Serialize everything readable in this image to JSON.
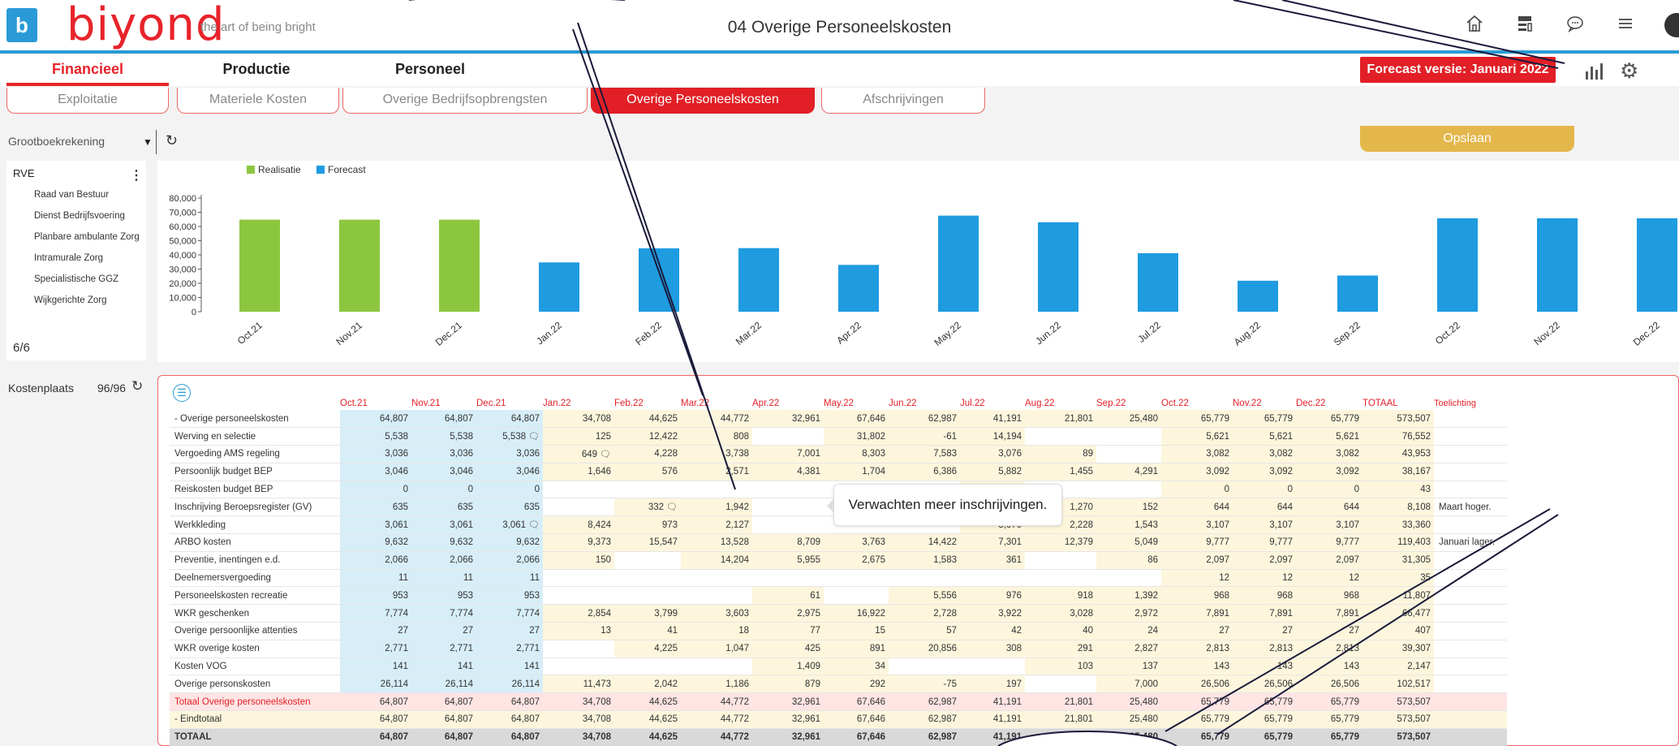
{
  "header": {
    "logo_letter": "b",
    "logo_word": "biyond",
    "tagline": "the art of being bright",
    "title": "04 Overige Personeelskosten"
  },
  "icons": {
    "home": "home-icon",
    "layout": "layout-icon",
    "chat": "chat-icon",
    "menu": "hamburger-menu-icon",
    "chart": "bar-chart-icon",
    "settings": "gear-icon"
  },
  "nav": {
    "tabs": [
      "Financieel",
      "Productie",
      "Personeel"
    ],
    "active": 0,
    "forecast_badge": "Forecast versie: Januari 2022"
  },
  "subtabs": {
    "items": [
      "Exploitatie",
      "Materiele Kosten",
      "Overige Bedrijfsopbrengsten",
      "Overige Personeelskosten",
      "Afschrijvingen"
    ],
    "active": 3
  },
  "filter": {
    "label": "Grootboekrekening",
    "save": "Opslaan"
  },
  "rve": {
    "title": "RVE",
    "items": [
      "Raad van Bestuur",
      "Dienst Bedrijfsvoering",
      "Planbare ambulante Zorg",
      "Intramurale Zorg",
      "Specialistische GGZ",
      "Wijkgerichte Zorg"
    ],
    "count": "6/6"
  },
  "kostenplaats": {
    "label": "Kostenplaats",
    "count": "96/96"
  },
  "colors": {
    "realisatie": "#8cc63f",
    "forecast": "#1f9be0",
    "accent": "#e21f26"
  },
  "chart_data": {
    "type": "bar",
    "categories": [
      "Oct.21",
      "Nov.21",
      "Dec.21",
      "Jan.22",
      "Feb.22",
      "Mar.22",
      "Apr.22",
      "May.22",
      "Jun.22",
      "Jul.22",
      "Aug.22",
      "Sep.22",
      "Oct.22",
      "Nov.22",
      "Dec.22"
    ],
    "series": [
      {
        "name": "Realisatie",
        "values": [
          64807,
          64807,
          64807,
          null,
          null,
          null,
          null,
          null,
          null,
          null,
          null,
          null,
          null,
          null,
          null
        ]
      },
      {
        "name": "Forecast",
        "values": [
          null,
          null,
          null,
          34708,
          44625,
          44772,
          32961,
          67646,
          62987,
          41191,
          21801,
          25480,
          65779,
          65779,
          65779
        ]
      }
    ],
    "yticks": [
      "80,000",
      "70,000",
      "60,000",
      "50,000",
      "40,000",
      "30,000",
      "20,000",
      "10,000",
      "0"
    ],
    "ylim": [
      0,
      80000
    ],
    "legend": "top-left",
    "grid": false
  },
  "table": {
    "columns": [
      "Oct.21",
      "Nov.21",
      "Dec.21",
      "Jan.22",
      "Feb.22",
      "Mar.22",
      "Apr.22",
      "May.22",
      "Jun.22",
      "Jul.22",
      "Aug.22",
      "Sep.22",
      "Oct.22",
      "Nov.22",
      "Dec.22",
      "TOTAAL",
      "Toelichting"
    ],
    "rows": [
      {
        "label": "- Overige personeelskosten",
        "values": [
          "64,807",
          "64,807",
          "64,807",
          "34,708",
          "44,625",
          "44,772",
          "32,961",
          "67,646",
          "62,987",
          "41,191",
          "21,801",
          "25,480",
          "65,779",
          "65,779",
          "65,779",
          "573,507"
        ],
        "note": ""
      },
      {
        "label": "Werving en selectie",
        "values": [
          "5,538",
          "5,538",
          "5,538",
          "125",
          "12,422",
          "808",
          "",
          "31,802",
          "-61",
          "14,194",
          "",
          "",
          "5,621",
          "5,621",
          "5,621",
          "76,552"
        ],
        "note": ""
      },
      {
        "label": "Vergoeding AMS regeling",
        "values": [
          "3,036",
          "3,036",
          "3,036",
          "649",
          "4,228",
          "3,738",
          "7,001",
          "8,303",
          "7,583",
          "3,076",
          "89",
          "",
          "3,082",
          "3,082",
          "3,082",
          "43,953"
        ],
        "note": ""
      },
      {
        "label": "Persoonlijk budget BEP",
        "values": [
          "3,046",
          "3,046",
          "3,046",
          "1,646",
          "576",
          "2,571",
          "4,381",
          "1,704",
          "6,386",
          "5,882",
          "1,455",
          "4,291",
          "3,092",
          "3,092",
          "3,092",
          "38,167"
        ],
        "note": ""
      },
      {
        "label": "Reiskosten budget BEP",
        "values": [
          "0",
          "0",
          "0",
          "",
          "",
          "",
          "",
          "",
          "",
          "42",
          "",
          "",
          "0",
          "0",
          "0",
          "43"
        ],
        "note": ""
      },
      {
        "label": "Inschrijving Beroepsregister (GV)",
        "values": [
          "635",
          "635",
          "635",
          "",
          "332",
          "1,942",
          "",
          "",
          "",
          "1,184",
          "1,270",
          "152",
          "644",
          "644",
          "644",
          "8,108"
        ],
        "note": "Maart hoger."
      },
      {
        "label": "Werkkleding",
        "values": [
          "3,061",
          "3,061",
          "3,061",
          "8,424",
          "973",
          "2,127",
          "",
          "",
          "",
          "3,670",
          "2,228",
          "1,543",
          "3,107",
          "3,107",
          "3,107",
          "33,360"
        ],
        "note": ""
      },
      {
        "label": "ARBO kosten",
        "values": [
          "9,632",
          "9,632",
          "9,632",
          "9,373",
          "15,547",
          "13,528",
          "8,709",
          "3,763",
          "14,422",
          "7,301",
          "12,379",
          "5,049",
          "9,777",
          "9,777",
          "9,777",
          "119,403"
        ],
        "note": "Januari lager."
      },
      {
        "label": "Preventie, inentingen e.d.",
        "values": [
          "2,066",
          "2,066",
          "2,066",
          "150",
          "",
          "14,204",
          "5,955",
          "2,675",
          "1,583",
          "361",
          "",
          "86",
          "2,097",
          "2,097",
          "2,097",
          "31,305"
        ],
        "note": ""
      },
      {
        "label": "Deelnemersvergoeding",
        "values": [
          "11",
          "11",
          "11",
          "",
          "",
          "",
          "",
          "",
          "",
          "",
          "",
          "",
          "12",
          "12",
          "12",
          "35"
        ],
        "note": ""
      },
      {
        "label": "Personeelskosten recreatie",
        "values": [
          "953",
          "953",
          "953",
          "",
          "",
          "",
          "61",
          "",
          "5,556",
          "976",
          "918",
          "1,392",
          "968",
          "968",
          "968",
          "11,807"
        ],
        "note": ""
      },
      {
        "label": "WKR geschenken",
        "values": [
          "7,774",
          "7,774",
          "7,774",
          "2,854",
          "3,799",
          "3,603",
          "2,975",
          "16,922",
          "2,728",
          "3,922",
          "3,028",
          "2,972",
          "7,891",
          "7,891",
          "7,891",
          "66,477"
        ],
        "note": ""
      },
      {
        "label": "Overige persoonlijke attenties",
        "values": [
          "27",
          "27",
          "27",
          "13",
          "41",
          "18",
          "77",
          "15",
          "57",
          "42",
          "40",
          "24",
          "27",
          "27",
          "27",
          "407"
        ],
        "note": ""
      },
      {
        "label": "WKR overige kosten",
        "values": [
          "2,771",
          "2,771",
          "2,771",
          "",
          "4,225",
          "1,047",
          "425",
          "891",
          "20,856",
          "308",
          "291",
          "2,827",
          "2,813",
          "2,813",
          "2,813",
          "39,307"
        ],
        "note": ""
      },
      {
        "label": "Kosten VOG",
        "values": [
          "141",
          "141",
          "141",
          "",
          "",
          "",
          "1,409",
          "34",
          "",
          "",
          "103",
          "137",
          "143",
          "143",
          "143",
          "2,147"
        ],
        "note": ""
      },
      {
        "label": "Overige personskosten",
        "values": [
          "26,114",
          "26,114",
          "26,114",
          "11,473",
          "2,042",
          "1,186",
          "879",
          "292",
          "-75",
          "197",
          "",
          "7,000",
          "26,506",
          "26,506",
          "26,506",
          "102,517"
        ],
        "note": ""
      },
      {
        "label": "Totaal Overige personeelskosten",
        "values": [
          "64,807",
          "64,807",
          "64,807",
          "34,708",
          "44,625",
          "44,772",
          "32,961",
          "67,646",
          "62,987",
          "41,191",
          "21,801",
          "25,480",
          "65,779",
          "65,779",
          "65,779",
          "573,507"
        ],
        "note": "",
        "kind": "sum"
      },
      {
        "label": "- Eindtotaal",
        "values": [
          "64,807",
          "64,807",
          "64,807",
          "34,708",
          "44,625",
          "44,772",
          "32,961",
          "67,646",
          "62,987",
          "41,191",
          "21,801",
          "25,480",
          "65,779",
          "65,779",
          "65,779",
          "573,507"
        ],
        "note": "",
        "kind": "sub"
      },
      {
        "label": "TOTAAL",
        "values": [
          "64,807",
          "64,807",
          "64,807",
          "34,708",
          "44,625",
          "44,772",
          "32,961",
          "67,646",
          "62,987",
          "41,191",
          "21,801",
          "25,480",
          "65,779",
          "65,779",
          "65,779",
          "573,507"
        ],
        "note": "",
        "kind": "grand"
      }
    ],
    "comments": [
      {
        "row": 1,
        "col": 2
      },
      {
        "row": 2,
        "col": 3
      },
      {
        "row": 5,
        "col": 4
      },
      {
        "row": 6,
        "col": 2
      }
    ]
  },
  "tooltip": {
    "text": "Verwachten meer inschrijvingen."
  }
}
